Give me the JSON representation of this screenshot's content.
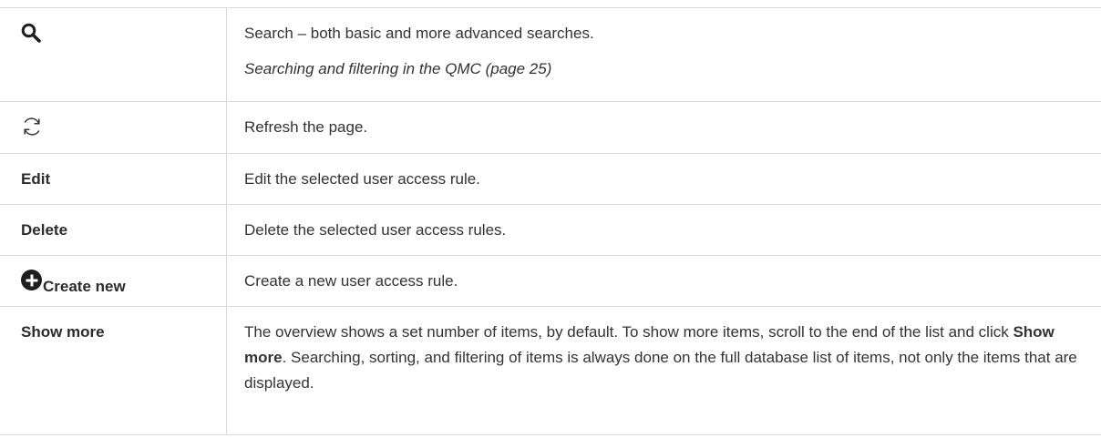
{
  "rows": [
    {
      "icon": "search-icon",
      "description": "Search – both basic and more advanced searches.",
      "link": "Searching and filtering in the QMC (page 25)"
    },
    {
      "icon": "refresh-icon",
      "description": "Refresh the page."
    },
    {
      "term": "Edit",
      "description": "Edit the selected user access rule."
    },
    {
      "term": "Delete",
      "description": "Delete the selected user access rules."
    },
    {
      "icon": "plus-circle-icon",
      "term": "Create new",
      "description": "Create a new user access rule."
    },
    {
      "term": "Show more",
      "description_before": "The overview shows a set number of items, by default. To show more items, scroll to the end of the list and click ",
      "description_bold": "Show more",
      "description_after": ". Searching, sorting, and filtering of items is always done on the full database list of items, not only the items that are displayed."
    }
  ]
}
